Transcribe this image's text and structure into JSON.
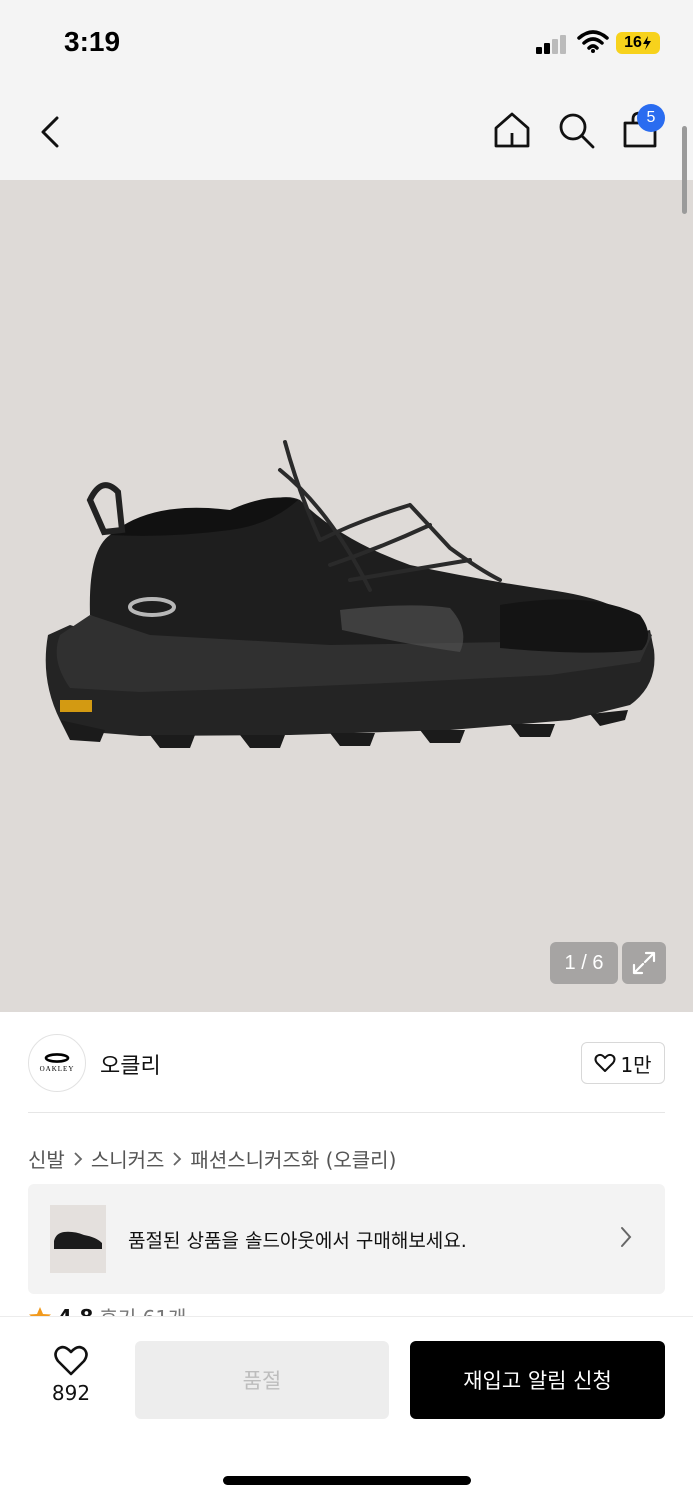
{
  "status_bar": {
    "time": "3:19",
    "battery": "16"
  },
  "nav": {
    "back_icon": "chevron-left-icon",
    "home_icon": "home-icon",
    "search_icon": "search-icon",
    "cart_icon": "shopping-bag-icon",
    "cart_badge": "5"
  },
  "gallery": {
    "counter": "1 / 6",
    "expand_icon": "expand-icon"
  },
  "brand": {
    "name": "오클리",
    "logo_text": "OAKLEY",
    "like_count": "1만"
  },
  "breadcrumb": [
    "신발",
    "스니커즈",
    "패션스니커즈화 (오클리)"
  ],
  "soldout_banner": {
    "text": "품절된 상품을 솔드아웃에서 구매해보세요."
  },
  "rating": {
    "score": "4.8",
    "reviews": "후기 61개"
  },
  "bottom_bar": {
    "wish_count": "892",
    "soldout_label": "품절",
    "restock_label": "재입고 알림 신청"
  },
  "colors": {
    "accent": "#2a6cf0",
    "battery": "#f7d21c",
    "image_bg": "#dedad7"
  }
}
